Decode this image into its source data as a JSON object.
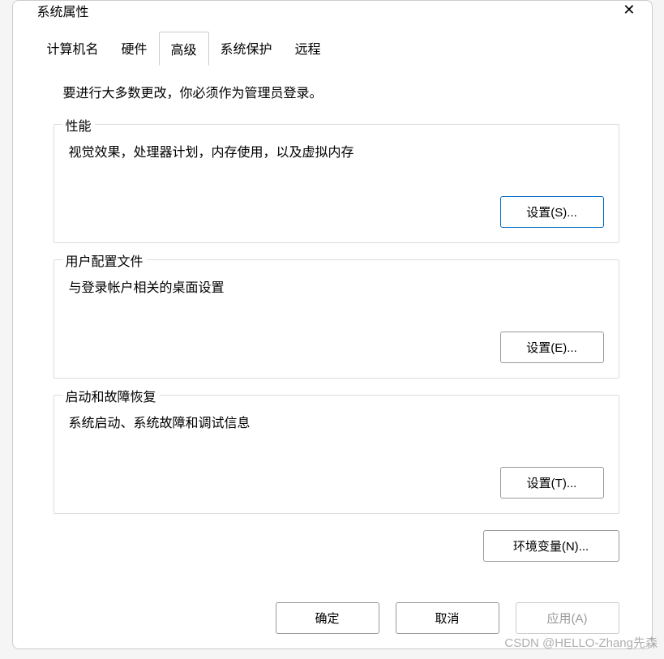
{
  "window": {
    "title": "系统属性",
    "close": "✕"
  },
  "tabs": {
    "computer_name": "计算机名",
    "hardware": "硬件",
    "advanced": "高级",
    "system_protection": "系统保护",
    "remote": "远程"
  },
  "intro": "要进行大多数更改，你必须作为管理员登录。",
  "performance": {
    "title": "性能",
    "desc": "视觉效果，处理器计划，内存使用，以及虚拟内存",
    "button": "设置(S)..."
  },
  "user_profiles": {
    "title": "用户配置文件",
    "desc": "与登录帐户相关的桌面设置",
    "button": "设置(E)..."
  },
  "startup": {
    "title": "启动和故障恢复",
    "desc": "系统启动、系统故障和调试信息",
    "button": "设置(T)..."
  },
  "env_button": "环境变量(N)...",
  "footer": {
    "ok": "确定",
    "cancel": "取消",
    "apply": "应用(A)"
  },
  "watermark": "CSDN @HELLO-Zhang先森"
}
